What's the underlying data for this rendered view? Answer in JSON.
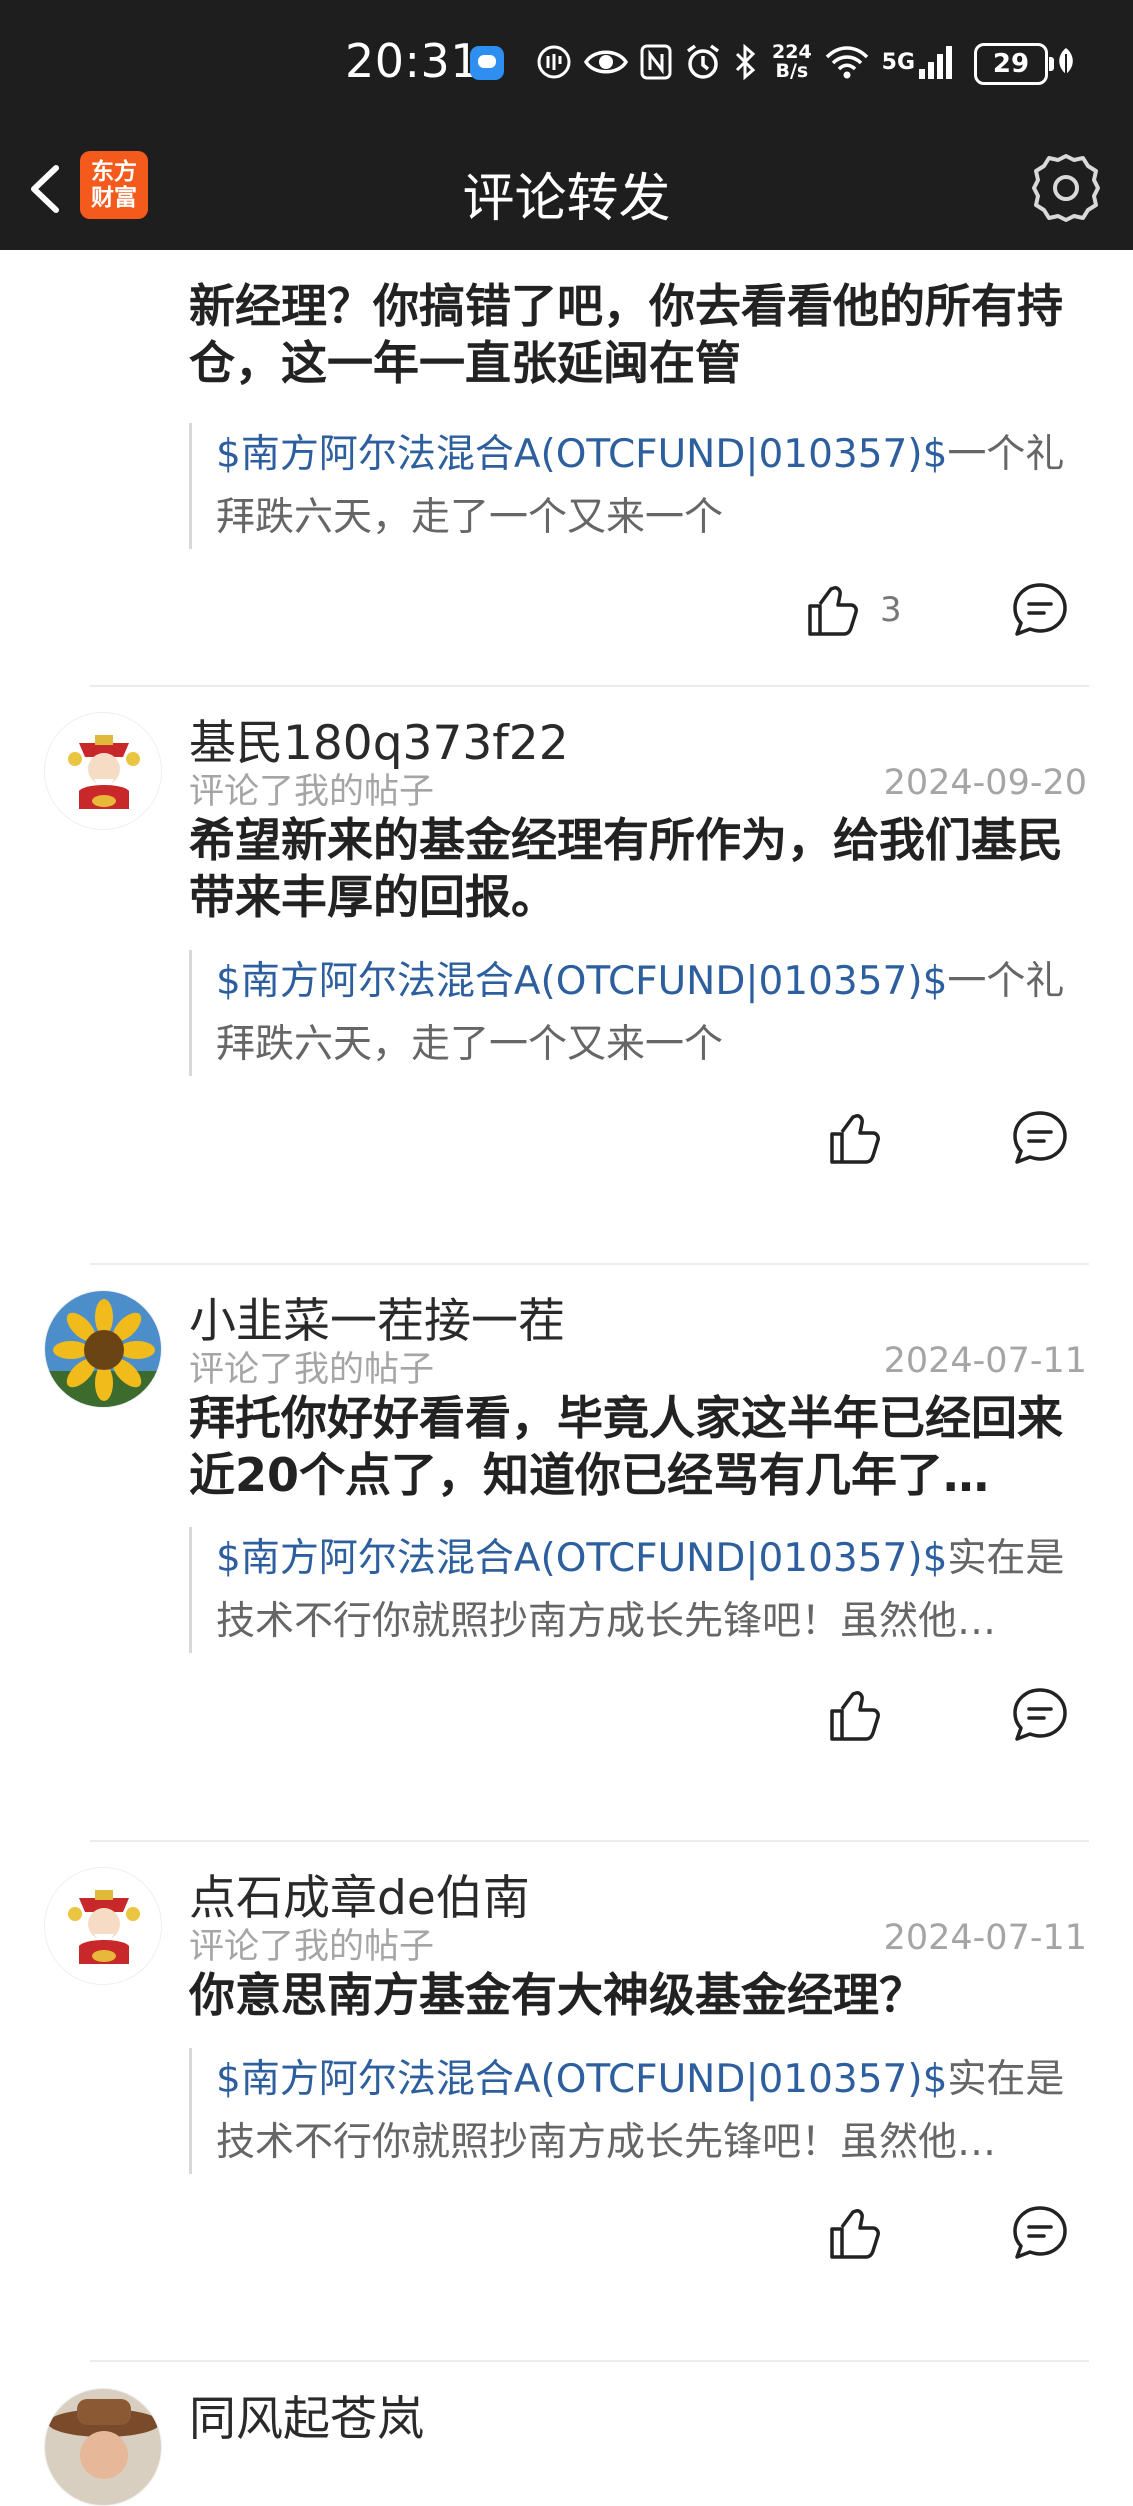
{
  "status_bar": {
    "time": "20:31",
    "net_speed_value": "224",
    "net_speed_unit": "B/s",
    "network": "5G",
    "battery": "29",
    "icons": [
      "message-app-icon",
      "nfc-like-icon",
      "eye-icon",
      "nfc-icon",
      "alarm-icon",
      "bluetooth-icon",
      "wifi-icon",
      "signal-icon",
      "battery-icon",
      "leaf-icon"
    ]
  },
  "header": {
    "logo_line1": "东方",
    "logo_line2": "财富",
    "title": "评论转发"
  },
  "colors": {
    "bar_bg": "#1e1e1e",
    "link_blue": "#2d5f9e",
    "logo_orange": "#f35a1c"
  },
  "posts": [
    {
      "comment": "新经理？你搞错了吧，你去看看他的所有持仓，这一年一直张延闽在管",
      "quote_fund": "$南方阿尔法混合A(OTCFUND|010357)$",
      "quote_line1_rest": "一个礼",
      "quote_line2": "拜跌六天，走了一个又来一个",
      "likes": "3"
    },
    {
      "username": "基民180q373f22",
      "action": "评论了我的帖子",
      "date": "2024-09-20",
      "avatar": "caishen-avatar",
      "comment": "希望新来的基金经理有所作为，给我们基民带来丰厚的回报。",
      "quote_fund": "$南方阿尔法混合A(OTCFUND|010357)$",
      "quote_line1_rest": "一个礼",
      "quote_line2": "拜跌六天，走了一个又来一个"
    },
    {
      "username": "小韭菜一茬接一茬",
      "action": "评论了我的帖子",
      "date": "2024-07-11",
      "avatar": "sunflower-avatar",
      "comment": "拜托你好好看看，毕竟人家这半年已经回来近20个点了，知道你已经骂有几年了…",
      "quote_fund": "$南方阿尔法混合A(OTCFUND|010357)$",
      "quote_line1_rest": "实在是",
      "quote_line2": "技术不行你就照抄南方成长先锋吧！虽然他…"
    },
    {
      "username": "点石成章de伯南",
      "action": "评论了我的帖子",
      "date": "2024-07-11",
      "avatar": "caishen-avatar",
      "comment": "你意思南方基金有大神级基金经理？",
      "quote_fund": "$南方阿尔法混合A(OTCFUND|010357)$",
      "quote_line1_rest": "实在是",
      "quote_line2": "技术不行你就照抄南方成长先锋吧！虽然他…"
    },
    {
      "username": "同风起苍岚",
      "avatar": "cowboy-hat-avatar"
    }
  ]
}
